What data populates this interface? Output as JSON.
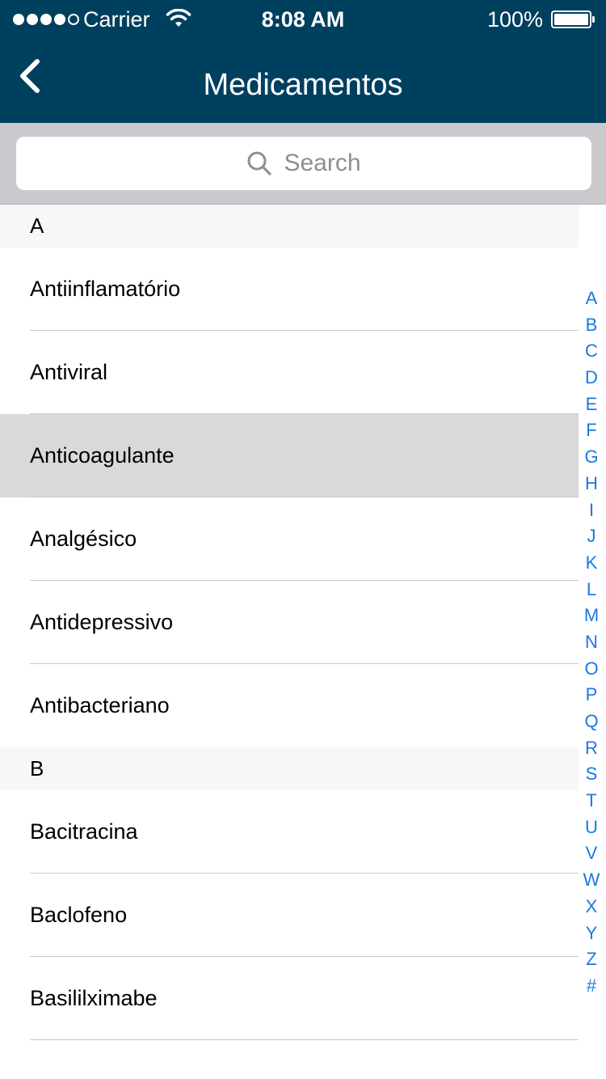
{
  "status_bar": {
    "carrier": "Carrier",
    "time": "8:08 AM",
    "battery": "100%",
    "battery_level": 1.0,
    "signal_bars_filled": 4,
    "signal_bars_total": 5
  },
  "nav": {
    "title": "Medicamentos",
    "back_icon": "chevron-left-icon"
  },
  "search": {
    "placeholder": "Search",
    "icon": "search-icon"
  },
  "sections": [
    {
      "header": "A",
      "items": [
        {
          "label": "Antiinflamatório"
        },
        {
          "label": "Antiviral"
        },
        {
          "label": "Anticoagulante"
        },
        {
          "label": "Analgésico"
        },
        {
          "label": "Antidepressivo"
        },
        {
          "label": "Antibacteriano"
        }
      ]
    },
    {
      "header": "B",
      "items": [
        {
          "label": "Bacitracina"
        },
        {
          "label": "Baclofeno"
        },
        {
          "label": "Basililximabe"
        }
      ]
    }
  ],
  "selected_item": "Anticoagulante",
  "index_letters": [
    "A",
    "B",
    "C",
    "D",
    "E",
    "F",
    "G",
    "H",
    "I",
    "J",
    "K",
    "L",
    "M",
    "N",
    "O",
    "P",
    "Q",
    "R",
    "S",
    "T",
    "U",
    "V",
    "W",
    "X",
    "Y",
    "Z",
    "#"
  ],
  "colors": {
    "nav_background": "#00405f",
    "index_accent": "#1a78e6",
    "selected_row": "#d9d9d9",
    "search_bar_background": "#c9c9ce"
  }
}
